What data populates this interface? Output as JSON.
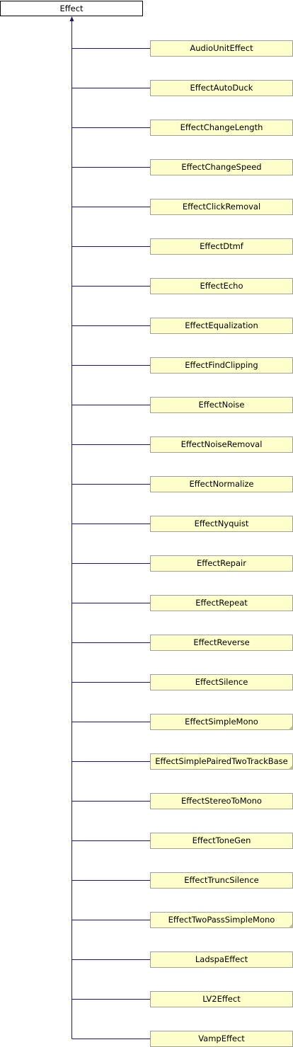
{
  "diagram": {
    "base_class": "Effect",
    "derived_classes": [
      {
        "name": "AudioUnitEffect",
        "has_more": false
      },
      {
        "name": "EffectAutoDuck",
        "has_more": false
      },
      {
        "name": "EffectChangeLength",
        "has_more": false
      },
      {
        "name": "EffectChangeSpeed",
        "has_more": false
      },
      {
        "name": "EffectClickRemoval",
        "has_more": false
      },
      {
        "name": "EffectDtmf",
        "has_more": false
      },
      {
        "name": "EffectEcho",
        "has_more": false
      },
      {
        "name": "EffectEqualization",
        "has_more": false
      },
      {
        "name": "EffectFindClipping",
        "has_more": false
      },
      {
        "name": "EffectNoise",
        "has_more": false
      },
      {
        "name": "EffectNoiseRemoval",
        "has_more": false
      },
      {
        "name": "EffectNormalize",
        "has_more": false
      },
      {
        "name": "EffectNyquist",
        "has_more": false
      },
      {
        "name": "EffectRepair",
        "has_more": false
      },
      {
        "name": "EffectRepeat",
        "has_more": false
      },
      {
        "name": "EffectReverse",
        "has_more": false
      },
      {
        "name": "EffectSilence",
        "has_more": false
      },
      {
        "name": "EffectSimpleMono",
        "has_more": true
      },
      {
        "name": "EffectSimplePairedTwoTrackBase",
        "has_more": true
      },
      {
        "name": "EffectStereoToMono",
        "has_more": false
      },
      {
        "name": "EffectToneGen",
        "has_more": false
      },
      {
        "name": "EffectTruncSilence",
        "has_more": false
      },
      {
        "name": "EffectTwoPassSimpleMono",
        "has_more": true
      },
      {
        "name": "LadspaEffect",
        "has_more": false
      },
      {
        "name": "LV2Effect",
        "has_more": false
      },
      {
        "name": "VampEffect",
        "has_more": false
      }
    ],
    "colors": {
      "base_fill": "#ffffff",
      "derived_fill": "#ffffcc",
      "box_border": "#000000",
      "derived_border": "#a0a0a0",
      "edge": "#191970",
      "more_marker": "#c0c0a0"
    }
  }
}
